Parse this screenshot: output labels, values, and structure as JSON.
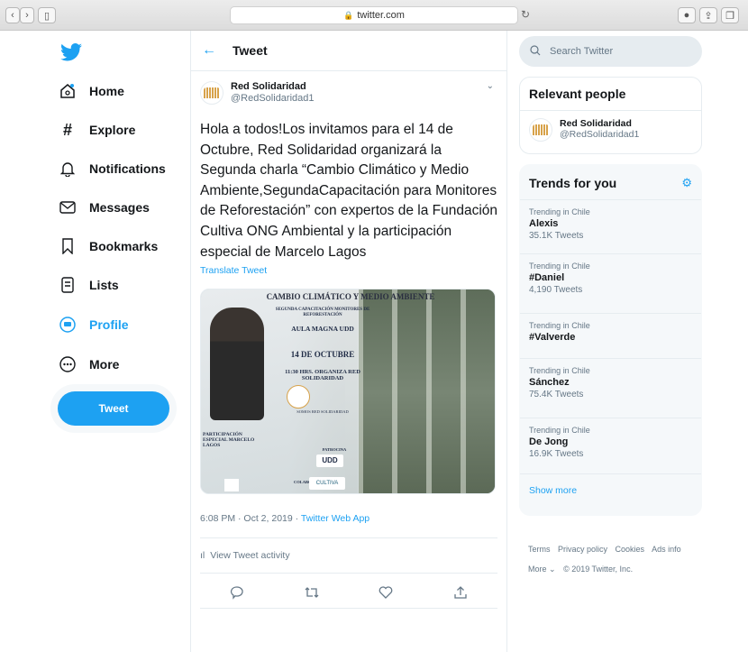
{
  "browser": {
    "url": "twitter.com",
    "lock_icon": "lock-icon"
  },
  "nav": {
    "items": [
      {
        "label": "Home",
        "icon": "home-icon"
      },
      {
        "label": "Explore",
        "icon": "hash-icon"
      },
      {
        "label": "Notifications",
        "icon": "bell-icon"
      },
      {
        "label": "Messages",
        "icon": "envelope-icon"
      },
      {
        "label": "Bookmarks",
        "icon": "bookmark-icon"
      },
      {
        "label": "Lists",
        "icon": "list-icon"
      },
      {
        "label": "Profile",
        "icon": "profile-icon"
      },
      {
        "label": "More",
        "icon": "more-icon"
      }
    ],
    "tweet_button": "Tweet",
    "accent": "#1da1f2"
  },
  "main": {
    "title": "Tweet",
    "author": {
      "name": "Red Solidaridad",
      "handle": "@RedSolidaridad1"
    },
    "text": "Hola a todos!Los invitamos para el 14 de Octubre, Red Solidaridad organizará la Segunda charla “Cambio Climático y Medio Ambiente,SegundaCapacitación para Monitores de Reforestación” con expertos de la Fundación Cultiva ONG Ambiental y la participación especial de Marcelo Lagos",
    "translate": "Translate Tweet",
    "media": {
      "headline": "CAMBIO CLIMÁTICO Y MEDIO AMBIENTE",
      "line1": "SEGUNDA CAPACITACIÓN MONITORES DE REFORESTACIÓN",
      "line2": "AULA MAGNA UDD",
      "line3": "14 DE OCTUBRE",
      "line4": "11:30 HRS. ORGANIZA RED SOLIDARIDAD",
      "line5": "SOMOS RED SOLIDARIDAD",
      "special": "PARTICIPACIÓN ESPECIAL MARCELO LAGOS",
      "sponsor": "PATROCINA",
      "sponsor_logo": "UDD",
      "collab": "COLABORA",
      "collab_logo": "CULTIVA"
    },
    "time": "6:08 PM · Oct 2, 2019 · ",
    "via": "Twitter Web App",
    "activity": "View Tweet activity"
  },
  "right": {
    "search_placeholder": "Search Twitter",
    "relevant_title": "Relevant people",
    "relevant_person": {
      "name": "Red Solidaridad",
      "handle": "@RedSolidaridad1"
    },
    "trends_title": "Trends for you",
    "trends": [
      {
        "context": "Trending in Chile",
        "name": "Alexis",
        "count": "35.1K Tweets"
      },
      {
        "context": "Trending in Chile",
        "name": "#Daniel",
        "count": "4,190 Tweets"
      },
      {
        "context": "Trending in Chile",
        "name": "#Valverde",
        "count": ""
      },
      {
        "context": "Trending in Chile",
        "name": "Sánchez",
        "count": "75.4K Tweets"
      },
      {
        "context": "Trending in Chile",
        "name": "De Jong",
        "count": "16.9K Tweets"
      }
    ],
    "show_more": "Show more",
    "footer": {
      "links": [
        "Terms",
        "Privacy policy",
        "Cookies",
        "Ads info"
      ],
      "more": "More ⌄",
      "copyright": "© 2019 Twitter, Inc."
    }
  }
}
